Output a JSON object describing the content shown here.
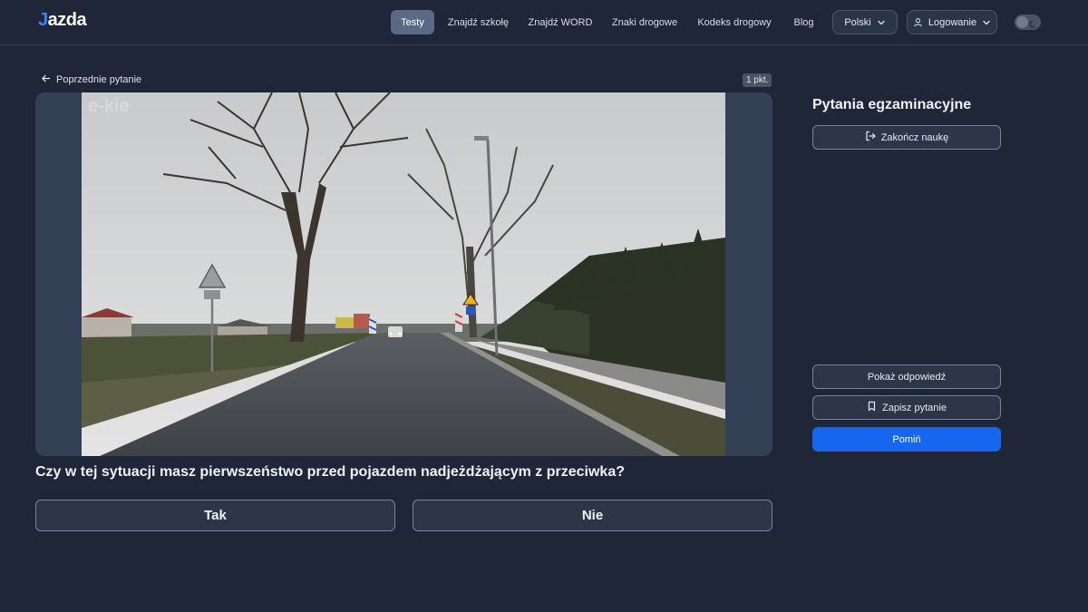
{
  "colors": {
    "background": "#1e2638",
    "accent": "#1766f0",
    "logo_mark": "#3b82f6",
    "active_nav": "#5a6a86"
  },
  "nav": {
    "logo_mark": "J",
    "logo_text": "azda",
    "links": [
      "Testy",
      "Znajdź szkołę",
      "Znajdź WORD",
      "Znaki drogowe",
      "Kodeks drogowy",
      "Blog"
    ],
    "active_link": "Testy",
    "language": "Polski",
    "login": "Logowanie"
  },
  "question_view": {
    "back_label": "Poprzednie pytanie",
    "points": "1 pkt.",
    "watermark": "e-kie",
    "question_text": "Czy w tej sytuacji masz pierwszeństwo przed pojazdem nadjeżdżającym z przeciwka?",
    "answers": [
      "Tak",
      "Nie"
    ]
  },
  "side_panel": {
    "title": "Pytania egzaminacyjne",
    "finish_label": "Zakończ naukę",
    "show_answer_label": "Pokaż odpowiedź",
    "save_label": "Zapisz pytanie",
    "skip_label": "Pomiń"
  },
  "icons": [
    "arrow-left-icon",
    "chevron-down-icon",
    "user-icon",
    "moon-icon",
    "logout-icon",
    "bookmark-icon"
  ]
}
